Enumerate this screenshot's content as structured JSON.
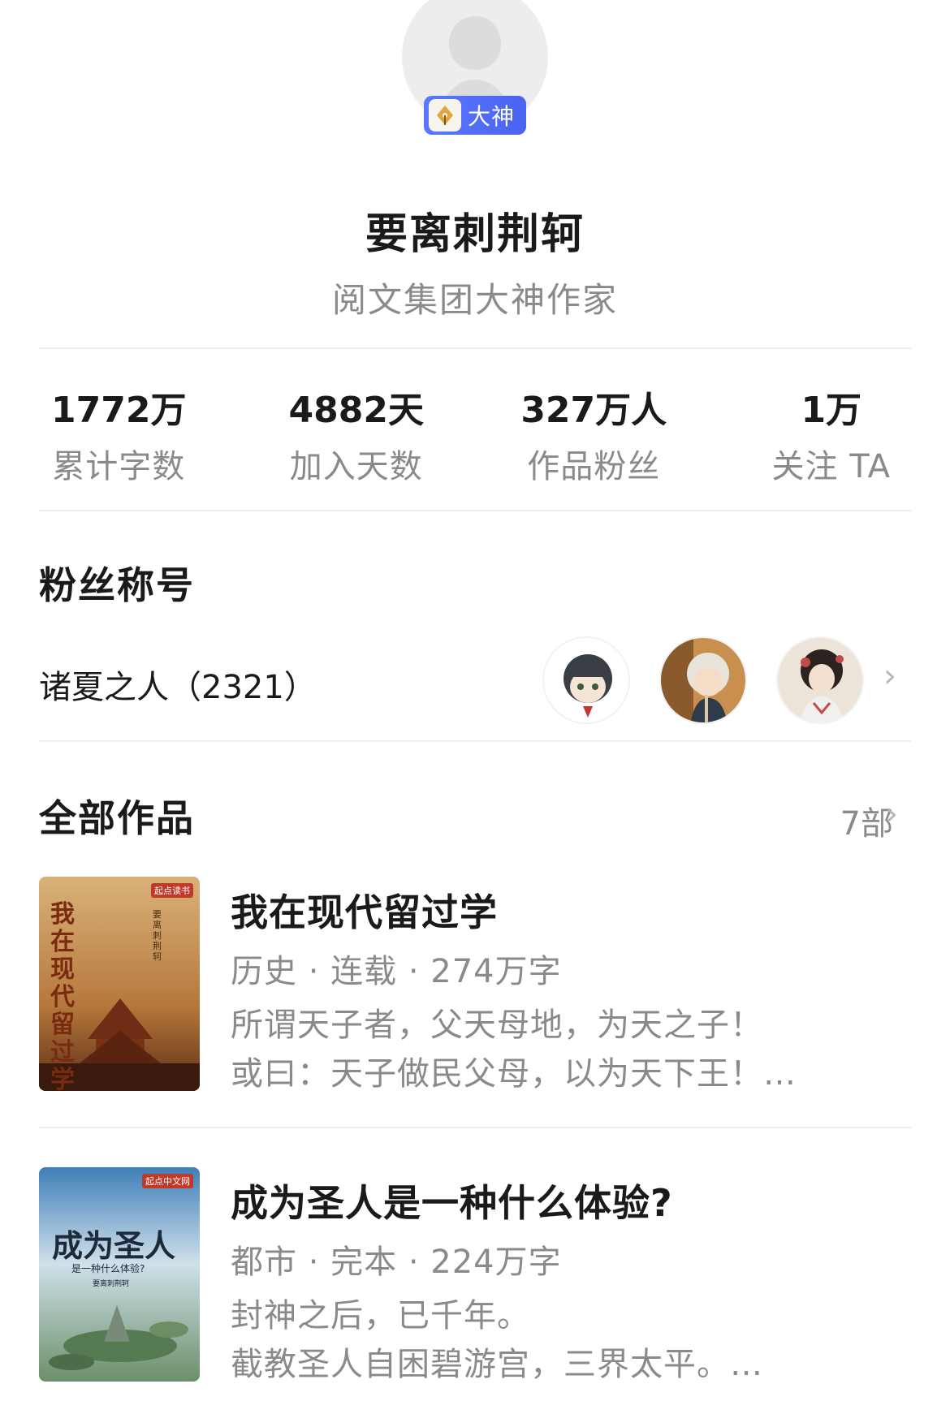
{
  "profile": {
    "badge_label": "大神",
    "name": "要离刺荆轲",
    "title": "阅文集团大神作家"
  },
  "stats": [
    {
      "value": "1772万",
      "label": "累计字数"
    },
    {
      "value": "4882天",
      "label": "加入天数"
    },
    {
      "value": "327万人",
      "label": "作品粉丝"
    },
    {
      "value": "1万",
      "label": "关注 TA"
    }
  ],
  "fans": {
    "section_title": "粉丝称号",
    "title_name": "诸夏之人（2321）"
  },
  "works": {
    "section_title": "全部作品",
    "count": "7部",
    "books": [
      {
        "title": "我在现代留过学",
        "meta": "历史 · 连载 · 274万字",
        "desc_line1": "所谓天子者，父天母地，为天之子！",
        "desc_line2": "或曰：天子做民父母，以为天下王！…",
        "cover_brand": "起点读书",
        "cover_title": "我在现代留过学",
        "cover_author": "要离刺荆轲"
      },
      {
        "title": "成为圣人是一种什么体验?",
        "meta": "都市 · 完本 · 224万字",
        "desc_line1": "封神之后，已千年。",
        "desc_line2": "截教圣人自困碧游宫，三界太平。…",
        "cover_brand": "起点中文网",
        "cover_title": "成为圣人",
        "cover_subtitle": "是一种什么体验?",
        "cover_author": "要离刺荆轲"
      }
    ]
  },
  "colors": {
    "badge": "#4a63f0",
    "primary_text": "#1a1a1a",
    "secondary_text": "#8a8a8a",
    "divider": "#ececec"
  }
}
